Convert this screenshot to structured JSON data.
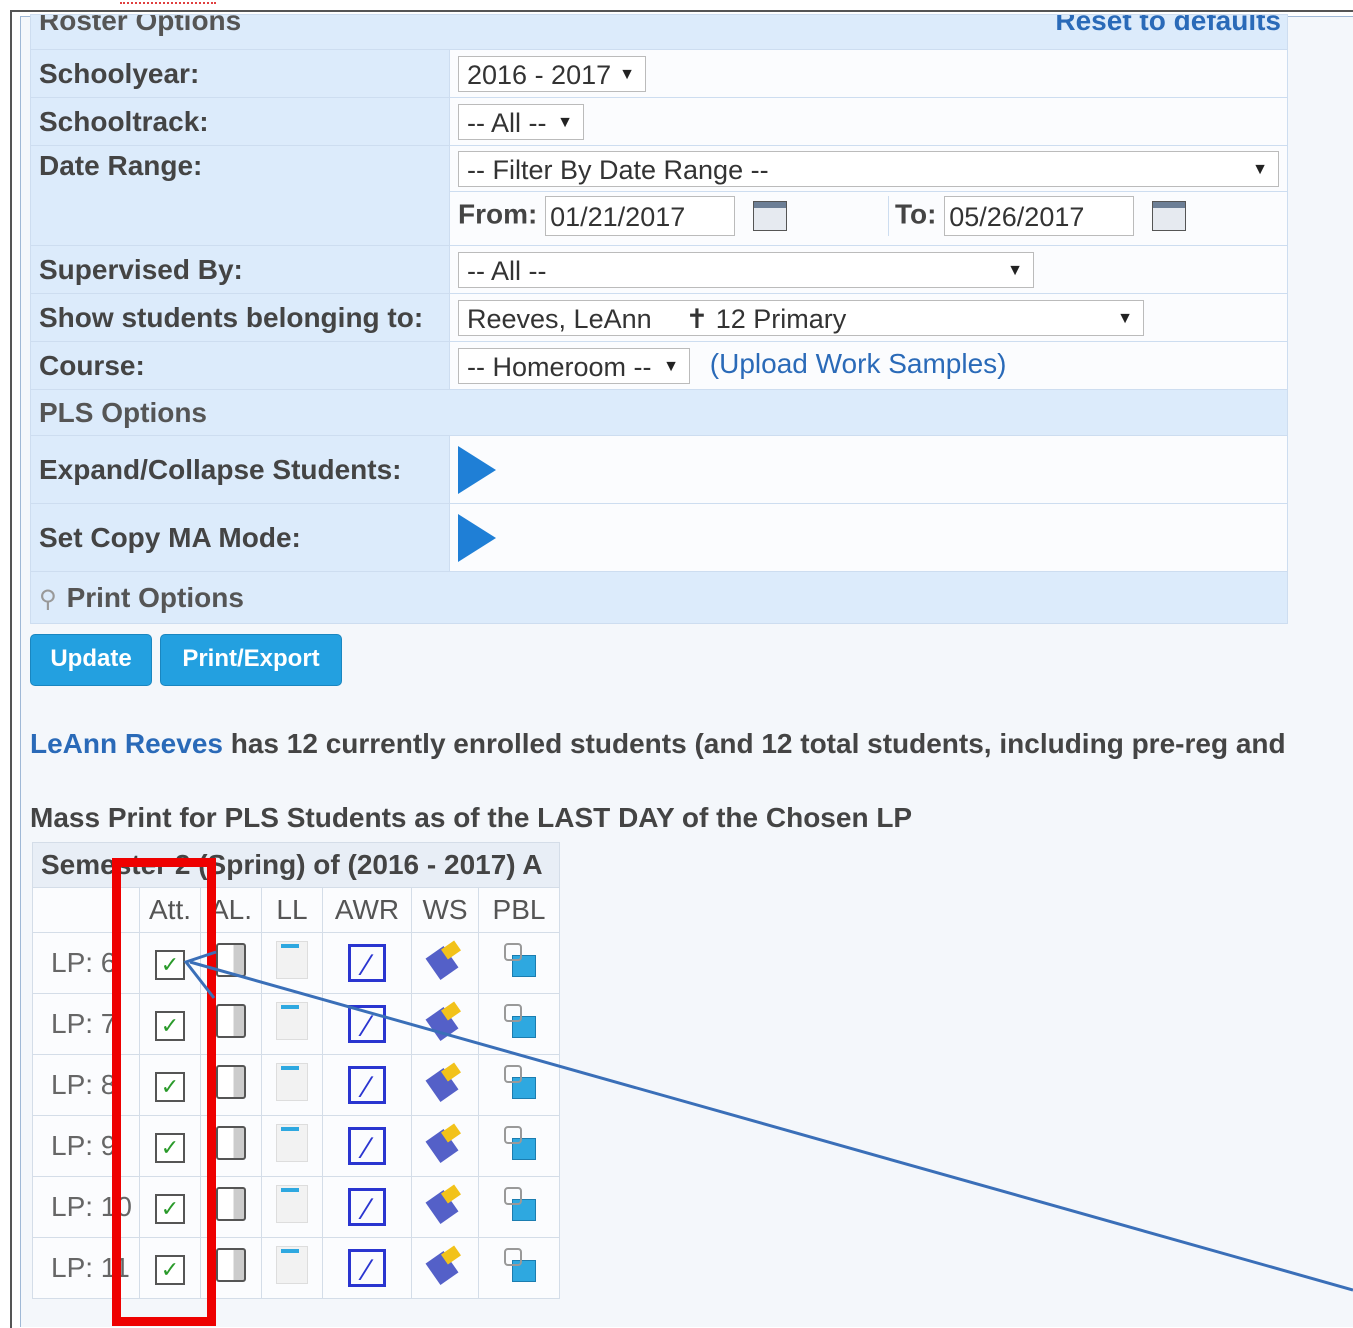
{
  "header": {
    "title": "Roster Options",
    "reset_link": "Reset to defaults"
  },
  "options": {
    "schoolyear": {
      "label": "Schoolyear:",
      "value": "2016 - 2017"
    },
    "schooltrack": {
      "label": "Schooltrack:",
      "value": "-- All --"
    },
    "date_range": {
      "label": "Date Range:",
      "value": "-- Filter By Date Range --",
      "from_label": "From:",
      "from_value": "01/21/2017",
      "to_label": "To:",
      "to_value": "05/26/2017"
    },
    "supervised_by": {
      "label": "Supervised By:",
      "value": "-- All --"
    },
    "show_students": {
      "label": "Show students belonging to:",
      "value": "Reeves, LeAnn",
      "count_value": "12 Primary"
    },
    "course": {
      "label": "Course:",
      "value": "-- Homeroom --",
      "link_open": "(",
      "link": "Upload Work Samples",
      "link_close": ")"
    },
    "pls_header": "PLS Options",
    "expand_collapse": {
      "label": "Expand/Collapse Students:"
    },
    "copy_ma": {
      "label": "Set Copy MA Mode:"
    },
    "print_options": "Print Options"
  },
  "buttons": {
    "update": "Update",
    "print_export": "Print/Export"
  },
  "summary": {
    "name": "LeAnn Reeves",
    "text": " has 12 currently enrolled students (and 12 total students, including pre-reg and"
  },
  "mass_print": {
    "title": "Mass Print for PLS Students as of the LAST DAY of the Chosen LP",
    "semester": "Semester 2 (Spring) of (2016 - 2017) A",
    "columns": [
      "Att.",
      "AL.",
      "LL",
      "AWR",
      "WS",
      "PBL"
    ],
    "rows": [
      "LP: 6",
      "LP: 7",
      "LP: 8",
      "LP: 9",
      "LP: 10",
      "LP: 11"
    ]
  },
  "colors": {
    "accent": "#23a0e0",
    "highlight": "#ee0000",
    "link": "#2a6ab8"
  },
  "icons": {
    "checkbox": "checkbox-checked-icon",
    "al": "document-stack-icon",
    "ll": "page-icon",
    "awr": "edit-pencil-icon",
    "ws": "paintbrush-icon",
    "pbl": "folder-icon",
    "calendar": "calendar-icon",
    "expand": "play-arrow-icon",
    "search": "magnifier-icon"
  }
}
